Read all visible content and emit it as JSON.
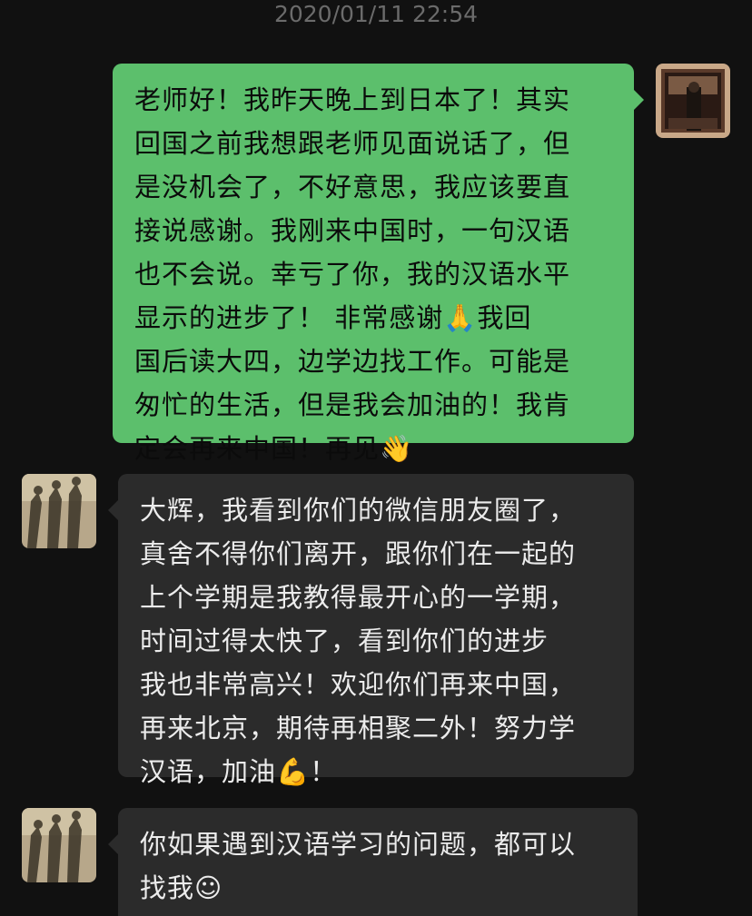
{
  "timestamp": "2020/01/11 22:54",
  "messages": [
    {
      "side": "outgoing",
      "lines": [
        "老师好！我昨天晚上到日本了！其实",
        "回国之前我想跟老师见面说话了，但",
        "是没机会了，不好意思，我应该要直",
        "接说感谢。我刚来中国时，一句汉语",
        "也不会说。幸亏了你，我的汉语水平",
        "显示的进步了！ 非常感谢🙏我回",
        "国后读大四，边学边找工作。可能是",
        "匆忙的生活，但是我会加油的！我肯",
        "定会再来中国！再见👋"
      ]
    },
    {
      "side": "incoming",
      "lines": [
        "大辉，我看到你们的微信朋友圈了，",
        "真舍不得你们离开，跟你们在一起的",
        "上个学期是我教得最开心的一学期，",
        "时间过得太快了，看到你们的进步",
        "我也非常高兴！欢迎你们再来中国，",
        "再来北京，期待再相聚二外！努力学",
        "汉语，加油💪！"
      ]
    },
    {
      "side": "incoming",
      "lines": [
        "你如果遇到汉语学习的问题，都可以",
        "找我☺"
      ]
    }
  ],
  "colors": {
    "background": "#111111",
    "outgoing_bubble": "#5cbf6c",
    "incoming_bubble": "#2b2b2b",
    "timestamp_text": "#6b6b6b"
  }
}
